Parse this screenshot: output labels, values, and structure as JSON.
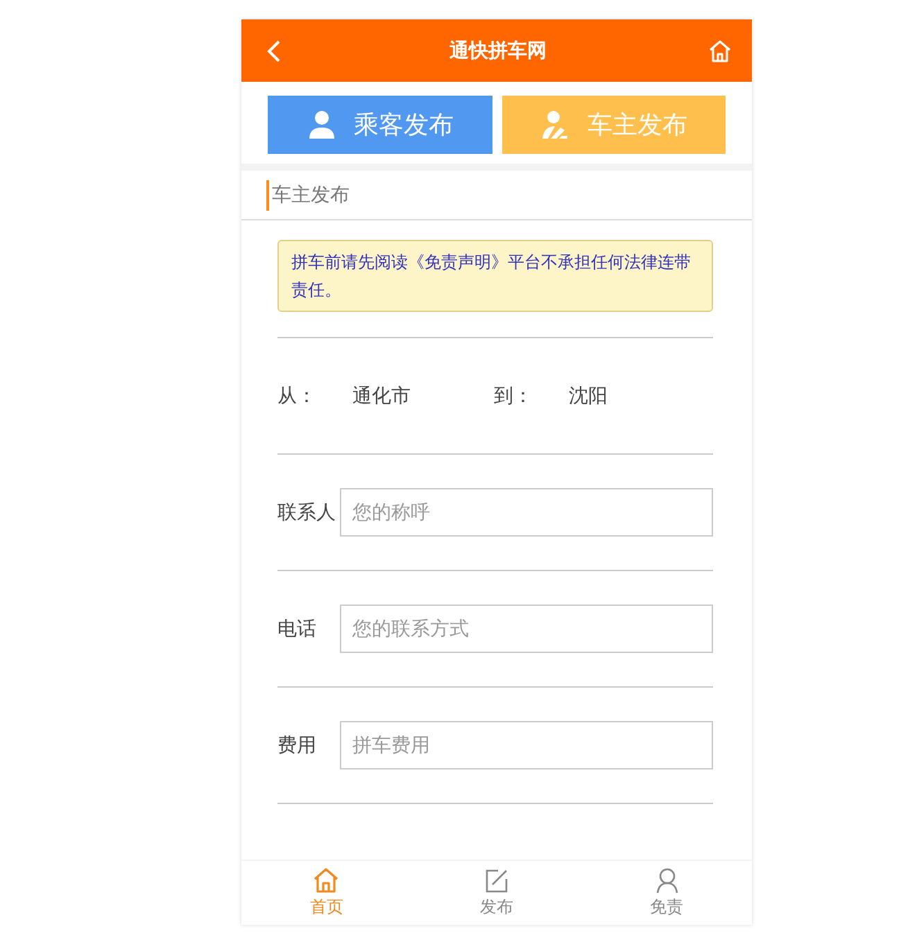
{
  "header": {
    "title": "通快拼车网"
  },
  "publish_buttons": [
    {
      "label": "乘客发布",
      "kind": "passenger",
      "color": "#5198f0"
    },
    {
      "label": "车主发布",
      "kind": "driver",
      "color": "#ffbf4d"
    }
  ],
  "section_title": "车主发布",
  "notice": "拼车前请先阅读《免责声明》平台不承担任何法律连带责任。",
  "route": {
    "from_label": "从：",
    "from_value": "通化市",
    "to_label": "到：",
    "to_value": "沈阳"
  },
  "fields": [
    {
      "label": "联系人",
      "placeholder": "您的称呼"
    },
    {
      "label": "电话",
      "placeholder": "您的联系方式"
    },
    {
      "label": "费用",
      "placeholder": "拼车费用"
    }
  ],
  "tabs": [
    {
      "label": "首页",
      "kind": "home",
      "selected": true
    },
    {
      "label": "发布",
      "kind": "edit",
      "selected": false
    },
    {
      "label": "免责",
      "kind": "person",
      "selected": false
    }
  ]
}
